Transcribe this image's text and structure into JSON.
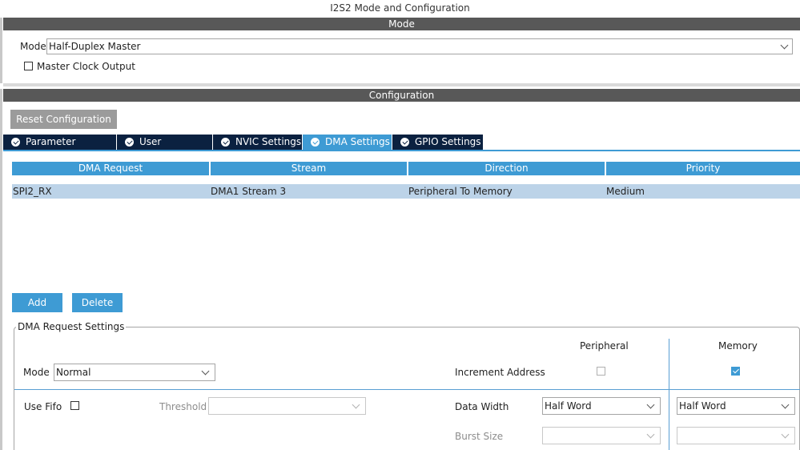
{
  "window": {
    "title": "I2S2 Mode and Configuration"
  },
  "mode_section": {
    "header": "Mode",
    "mode_label": "Mode",
    "mode_value": "Half-Duplex Master",
    "master_clock_label": "Master Clock Output",
    "master_clock_checked": false
  },
  "config_section": {
    "header": "Configuration",
    "reset_label": "Reset Configuration",
    "tabs": [
      {
        "label": "Parameter Settings",
        "active": false
      },
      {
        "label": "User Constants",
        "active": false
      },
      {
        "label": "NVIC Settings",
        "active": false
      },
      {
        "label": "DMA Settings",
        "active": true
      },
      {
        "label": "GPIO Settings",
        "active": false
      }
    ]
  },
  "dma_table": {
    "columns": [
      "DMA Request",
      "Stream",
      "Direction",
      "Priority"
    ],
    "rows": [
      [
        "SPI2_RX",
        "DMA1 Stream 3",
        "Peripheral To Memory",
        "Medium"
      ]
    ]
  },
  "buttons": {
    "add": "Add",
    "delete": "Delete"
  },
  "request_settings": {
    "legend": "DMA Request Settings",
    "mode_label": "Mode",
    "mode_value": "Normal",
    "use_fifo_label": "Use Fifo",
    "use_fifo_checked": false,
    "threshold_label": "Threshold",
    "threshold_value": "",
    "peripheral_header": "Peripheral",
    "memory_header": "Memory",
    "increment_label": "Increment Address",
    "peripheral_increment": false,
    "memory_increment": true,
    "data_width_label": "Data Width",
    "peripheral_width": "Half Word",
    "memory_width": "Half Word",
    "burst_label": "Burst Size",
    "peripheral_burst": "",
    "memory_burst": ""
  },
  "colors": {
    "accent": "#3e9bd4",
    "tab_dark": "#0b2140",
    "section_bar": "#585858",
    "row_selected": "#bcd3e8"
  }
}
